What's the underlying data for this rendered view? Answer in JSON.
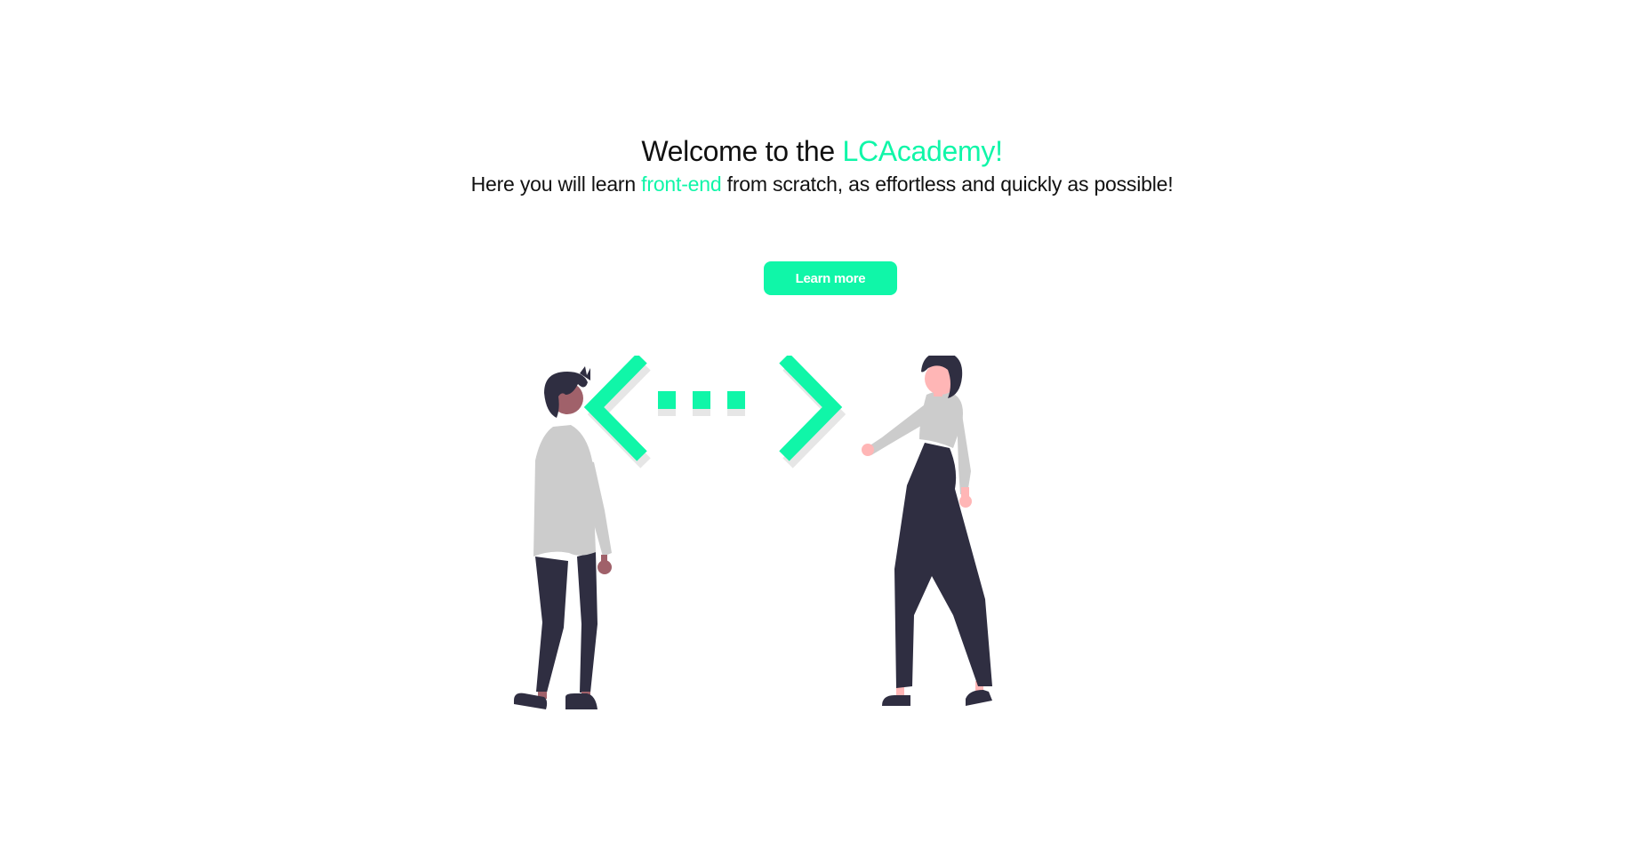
{
  "hero": {
    "title_prefix": "Welcome to the ",
    "title_highlight": "LCAcademy!",
    "subtitle_prefix": "Here you will learn ",
    "subtitle_highlight": "front-end",
    "subtitle_suffix": " from scratch, as effortless and quickly as possible!"
  },
  "cta": {
    "label": "Learn more"
  },
  "illustration": {
    "icon_names": [
      "person-left-icon",
      "code-brackets-icon",
      "person-right-icon"
    ]
  },
  "colors": {
    "accent": "#10f6a8",
    "text": "#111111",
    "skin_dark": "#a0616a",
    "skin_light": "#ffb6b6",
    "shirt": "#cccccc",
    "pants": "#2f2e41",
    "shadow": "#e6e6e6"
  }
}
